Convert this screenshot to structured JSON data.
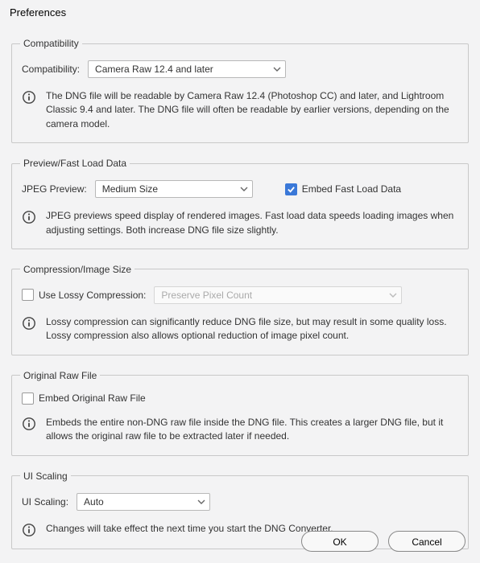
{
  "window": {
    "title": "Preferences"
  },
  "compatibility": {
    "legend": "Compatibility",
    "label": "Compatibility:",
    "selected": "Camera Raw 12.4 and later",
    "info": "The DNG file will be readable by Camera Raw 12.4 (Photoshop CC) and later, and Lightroom Classic 9.4 and later. The DNG file will often be readable by earlier versions, depending on the camera model."
  },
  "preview": {
    "legend": "Preview/Fast Load Data",
    "jpeg_label": "JPEG Preview:",
    "jpeg_selected": "Medium Size",
    "embed_label": "Embed Fast Load Data",
    "embed_checked": true,
    "info": "JPEG previews speed display of rendered images.  Fast load data speeds loading images when adjusting settings.  Both increase DNG file size slightly."
  },
  "compression": {
    "legend": "Compression/Image Size",
    "use_lossy_label": "Use Lossy Compression:",
    "use_lossy_checked": false,
    "preserve_selected": "Preserve Pixel Count",
    "info": "Lossy compression can significantly reduce DNG file size, but may result in some quality loss.  Lossy compression also allows optional reduction of image pixel count."
  },
  "original": {
    "legend": "Original Raw File",
    "embed_label": "Embed Original Raw File",
    "embed_checked": false,
    "info": "Embeds the entire non-DNG raw file inside the DNG file.  This creates a larger DNG file, but it allows the original raw file to be extracted later if needed."
  },
  "uiscaling": {
    "legend": "UI Scaling",
    "label": "UI Scaling:",
    "selected": "Auto",
    "info": "Changes will take effect the next time you start the DNG Converter."
  },
  "buttons": {
    "ok": "OK",
    "cancel": "Cancel"
  }
}
